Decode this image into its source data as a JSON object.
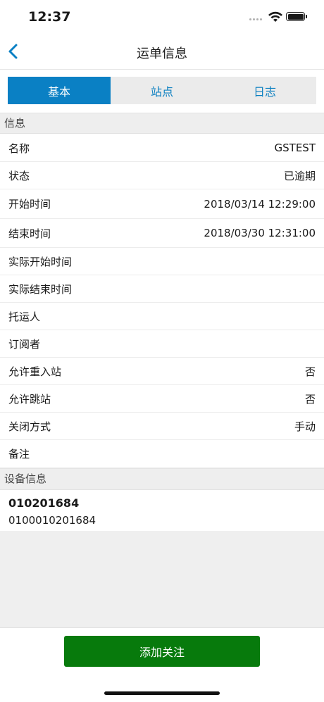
{
  "status_bar": {
    "time": "12:37"
  },
  "nav": {
    "title": "运单信息"
  },
  "tabs": [
    {
      "label": "基本",
      "active": true
    },
    {
      "label": "站点",
      "active": false
    },
    {
      "label": "日志",
      "active": false
    }
  ],
  "info_section": {
    "header": "信息",
    "rows": [
      {
        "label": "名称",
        "value": "GSTEST"
      },
      {
        "label": "状态",
        "value": "已逾期"
      },
      {
        "label": "开始时间",
        "value": "2018/03/14 12:29:00"
      },
      {
        "label": "结束时间",
        "value": "2018/03/30 12:31:00"
      },
      {
        "label": "实际开始时间",
        "value": ""
      },
      {
        "label": "实际结束时间",
        "value": ""
      },
      {
        "label": "托运人",
        "value": ""
      },
      {
        "label": "订阅者",
        "value": ""
      },
      {
        "label": "允许重入站",
        "value": "否"
      },
      {
        "label": "允许跳站",
        "value": "否"
      },
      {
        "label": "关闭方式",
        "value": "手动"
      },
      {
        "label": "备注",
        "value": ""
      }
    ]
  },
  "device_section": {
    "header": "设备信息",
    "device_name": "010201684",
    "device_code": "0100010201684"
  },
  "footer": {
    "button_label": "添加关注"
  },
  "colors": {
    "accent": "#0a80c4",
    "button": "#077a0c"
  }
}
